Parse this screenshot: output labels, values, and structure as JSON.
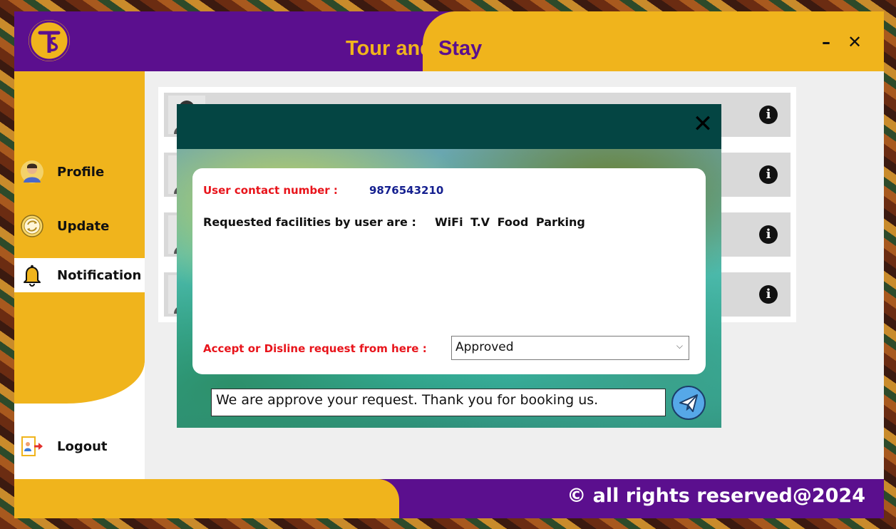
{
  "app": {
    "title_part1": "Tour and",
    "title_part2": "Stay",
    "minimize": "–",
    "close": "✕",
    "logo_icon": "ts-logo-icon"
  },
  "sidebar": {
    "items": [
      {
        "label": "Profile",
        "icon": "user-avatar-icon"
      },
      {
        "label": "Update",
        "icon": "refresh-icon"
      },
      {
        "label": "Notification",
        "icon": "bell-icon"
      },
      {
        "label": "Logout",
        "icon": "logout-icon"
      }
    ],
    "active": "Notification"
  },
  "notifications": {
    "rows": [
      {
        "avatar": "user-silhouette-icon",
        "action": "info-icon"
      },
      {
        "avatar": "user-silhouette-icon",
        "action": "info-icon"
      },
      {
        "avatar": "user-silhouette-icon",
        "action": "info-icon"
      },
      {
        "avatar": "user-silhouette-icon",
        "action": "info-icon"
      }
    ],
    "info_glyph": "i"
  },
  "modal": {
    "close": "✕",
    "contact_label": "User contact number :",
    "contact_value": "9876543210",
    "facilities_label": "Requested facilities by user are :",
    "facilities_value": "WiFi  T.V  Food  Parking",
    "accept_label": "Accept or Disline request from here :",
    "status_select": {
      "value": "Approved",
      "chevron": "⌵"
    },
    "message_input": {
      "value": "We are approve your request. Thank you for booking us."
    },
    "send_icon": "send-paper-plane-icon"
  },
  "footer": {
    "copyright": "© all rights reserved@2024"
  },
  "colors": {
    "purple": "#5b0f8e",
    "gold": "#f0b41c",
    "teal_header": "#044543",
    "label_red": "#e8141b",
    "value_blue": "#141f8f"
  }
}
